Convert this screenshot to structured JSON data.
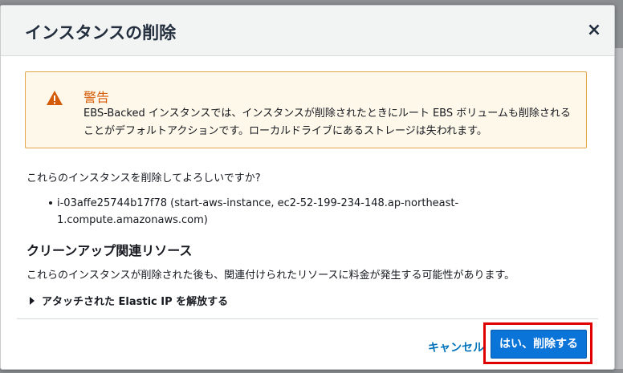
{
  "dialog": {
    "title": "インスタンスの削除",
    "close_glyph": "×"
  },
  "warning": {
    "icon": "warning-triangle-icon",
    "title": "警告",
    "text": "EBS-Backed インスタンスでは、インスタンスが削除されたときにルート EBS ボリュームも削除されることがデフォルトアクションです。ローカルドライブにあるストレージは失われます。"
  },
  "question": "これらのインスタンスを削除してよろしいですか?",
  "instances": [
    "i-03affe25744b17f78 (start-aws-instance, ec2-52-199-234-148.ap-northeast-1.compute.amazonaws.com)"
  ],
  "cleanup": {
    "title": "クリーンアップ関連リソース",
    "description": "これらのインスタンスが削除された後も、関連付けられたリソースに料金が発生する可能性があります。",
    "expander_label": "アタッチされた Elastic IP を解放する"
  },
  "footer": {
    "cancel_label": "キャンセル",
    "confirm_label": "はい、削除する"
  },
  "colors": {
    "primary": "#0a74d8",
    "warning_border": "#e3a54a",
    "warning_title": "#d45b07",
    "highlight": "#e00000"
  }
}
